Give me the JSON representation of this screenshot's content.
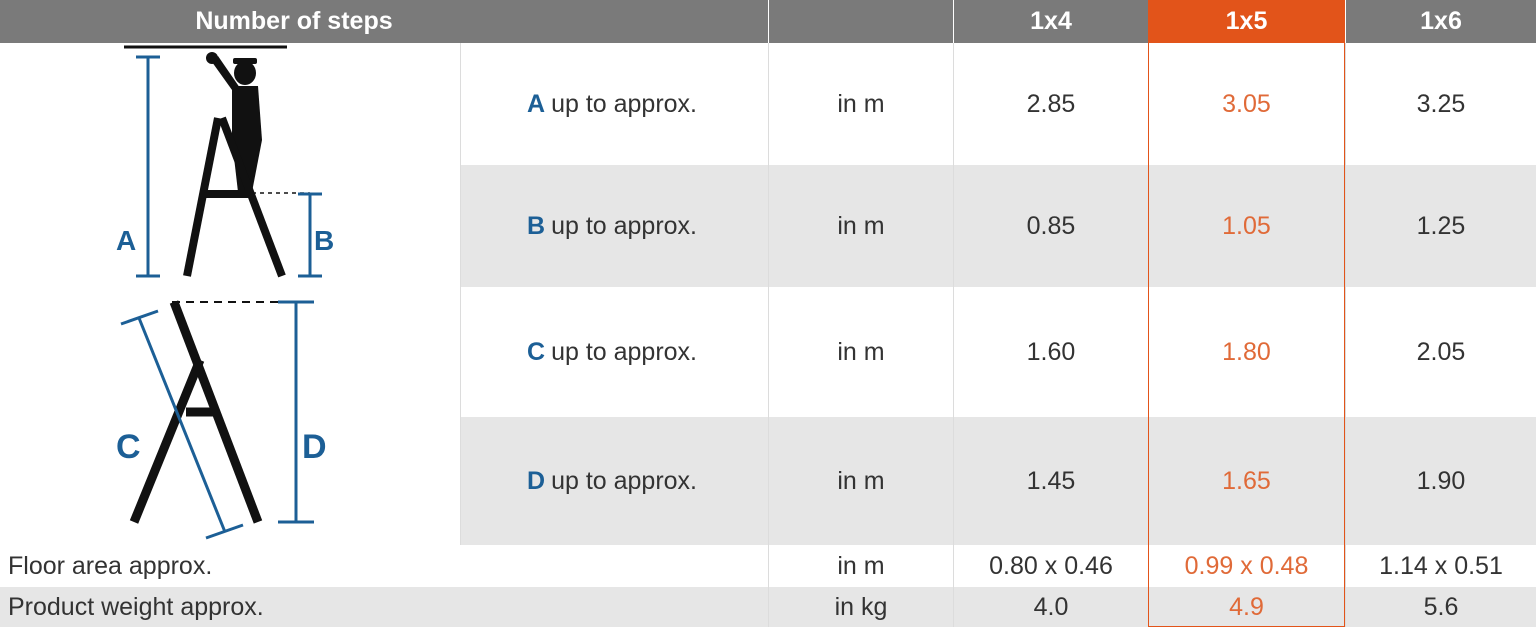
{
  "header": {
    "title": "Number of steps",
    "columns": [
      "1x4",
      "1x5",
      "1x6"
    ]
  },
  "highlight_color": "#e2541a",
  "label_color": "#1c5f96",
  "rows": [
    {
      "letter": "A",
      "text": "up to approx.",
      "unit": "in m",
      "values": [
        "2.85",
        "3.05",
        "3.25"
      ]
    },
    {
      "letter": "B",
      "text": "up to approx.",
      "unit": "in m",
      "values": [
        "0.85",
        "1.05",
        "1.25"
      ]
    },
    {
      "letter": "C",
      "text": "up to approx.",
      "unit": "in m",
      "values": [
        "1.60",
        "1.80",
        "2.05"
      ]
    },
    {
      "letter": "D",
      "text": "up to approx.",
      "unit": "in m",
      "values": [
        "1.45",
        "1.65",
        "1.90"
      ]
    }
  ],
  "footer_rows": [
    {
      "label": "Floor area approx.",
      "unit": "in m",
      "values": [
        "0.80 x 0.46",
        "0.99 x 0.48",
        "1.14 x 0.51"
      ]
    },
    {
      "label": "Product weight approx.",
      "unit": "in kg",
      "values": [
        "4.0",
        "4.9",
        "5.6"
      ]
    }
  ],
  "diagram": {
    "top_letters": [
      "A",
      "B"
    ],
    "bottom_letters": [
      "C",
      "D"
    ]
  }
}
